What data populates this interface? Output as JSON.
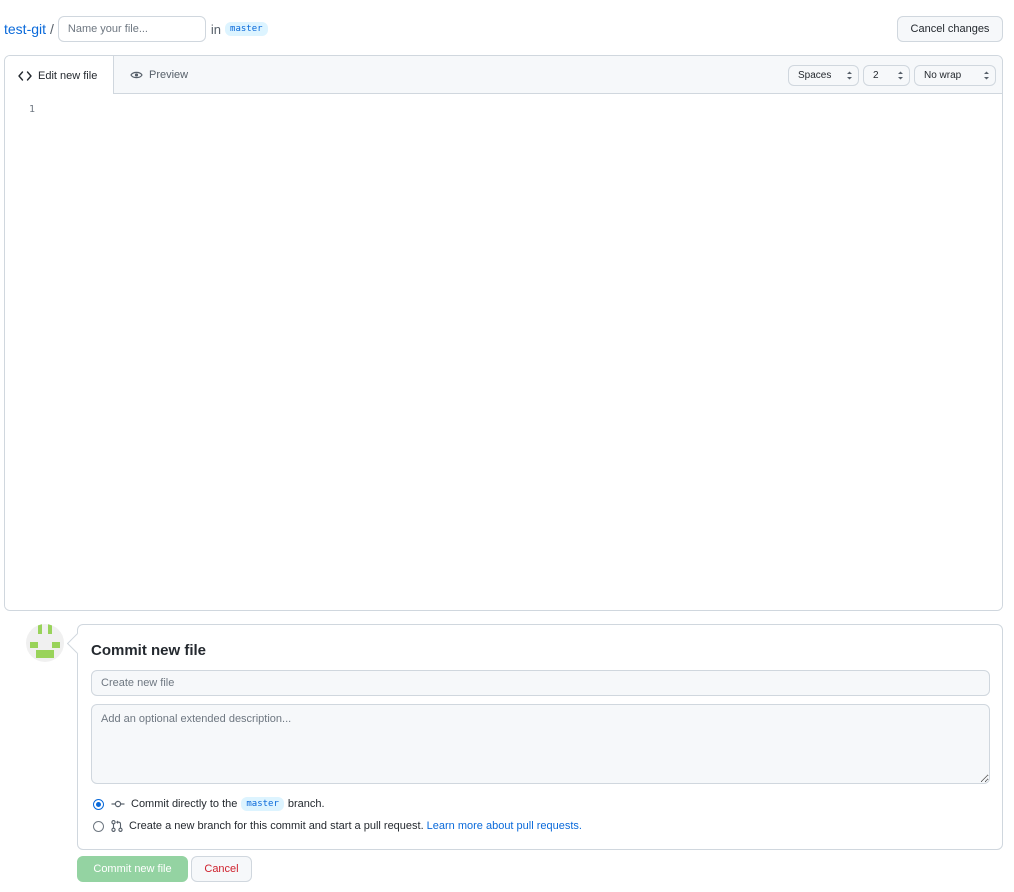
{
  "header": {
    "repo_name": "test-git",
    "separator": "/",
    "filename_placeholder": "Name your file...",
    "filename_value": "",
    "in_label": "in",
    "branch": "master",
    "cancel_changes_label": "Cancel changes"
  },
  "editor": {
    "tabs": [
      {
        "label": "Edit new file",
        "icon": "code-icon",
        "active": true
      },
      {
        "label": "Preview",
        "icon": "eye-icon",
        "active": false
      }
    ],
    "indent_mode": "Spaces",
    "indent_size": "2",
    "wrap_mode": "No wrap",
    "line_numbers": [
      "1"
    ]
  },
  "commit": {
    "title": "Commit new file",
    "summary_placeholder": "Create new file",
    "description_placeholder": "Add an optional extended description...",
    "option_direct": {
      "prefix": "Commit directly to the",
      "branch": "master",
      "suffix": "branch.",
      "checked": true
    },
    "option_new_branch": {
      "bold_part": "Create a new branch",
      "rest": "for this commit and start a pull request.",
      "link": "Learn more about pull requests.",
      "checked": false
    },
    "commit_button": "Commit new file",
    "cancel_button": "Cancel"
  },
  "colors": {
    "link": "#0969da",
    "commit_button_disabled": "#94d3a2",
    "cancel_red": "#cf222e",
    "border": "#d0d7de"
  }
}
